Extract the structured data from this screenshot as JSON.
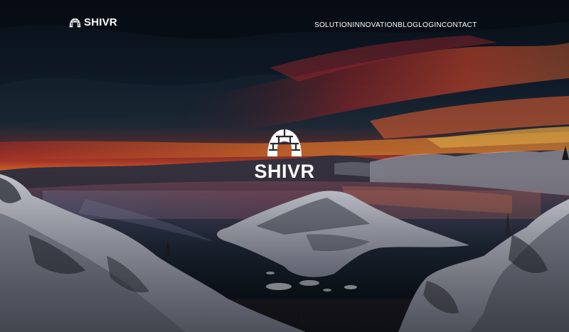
{
  "brand": {
    "name": "SHIVR",
    "icon": "igloo-icon"
  },
  "nav": {
    "items": [
      {
        "label": "SOLUTION"
      },
      {
        "label": "INNOVATION"
      },
      {
        "label": "BLOG"
      },
      {
        "label": "LOGIN"
      },
      {
        "label": "CONTACT"
      }
    ]
  },
  "hero": {
    "logo_text": "SHIVR",
    "logo_icon": "igloo-icon",
    "background": "crater-lake-sunset-photo"
  },
  "colors": {
    "text": "#ffffff",
    "sky_dark": "#0b1420",
    "sunset_red": "#c8322c",
    "sunset_orange": "#e0752a"
  }
}
